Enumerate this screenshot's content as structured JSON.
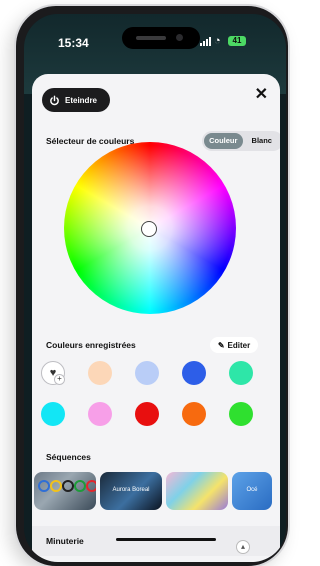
{
  "status_bar": {
    "time": "15:34",
    "battery": "41"
  },
  "header": {
    "power_label": "Eteindre",
    "close_glyph": "✕"
  },
  "color_picker": {
    "title": "Sélecteur de couleurs",
    "modes": [
      {
        "label": "Couleur",
        "active": true
      },
      {
        "label": "Blanc",
        "active": false
      }
    ]
  },
  "saved_colors": {
    "title": "Couleurs enregistrées",
    "edit_label": "Editer",
    "add_icon": "heart-add-icon",
    "swatches": [
      "#fcd7b8",
      "#b9cdf7",
      "#2d5ee8",
      "#2ee6a8",
      "#12e6f5",
      "#f79fe8",
      "#e80f0f",
      "#f76a0f",
      "#2fe02f"
    ]
  },
  "sequences": {
    "title": "Séquences",
    "items": [
      {
        "label": ""
      },
      {
        "label": "Aurora Boreal"
      },
      {
        "label": ""
      },
      {
        "label": "Océ"
      }
    ]
  },
  "timer": {
    "title": "Minuterie"
  }
}
